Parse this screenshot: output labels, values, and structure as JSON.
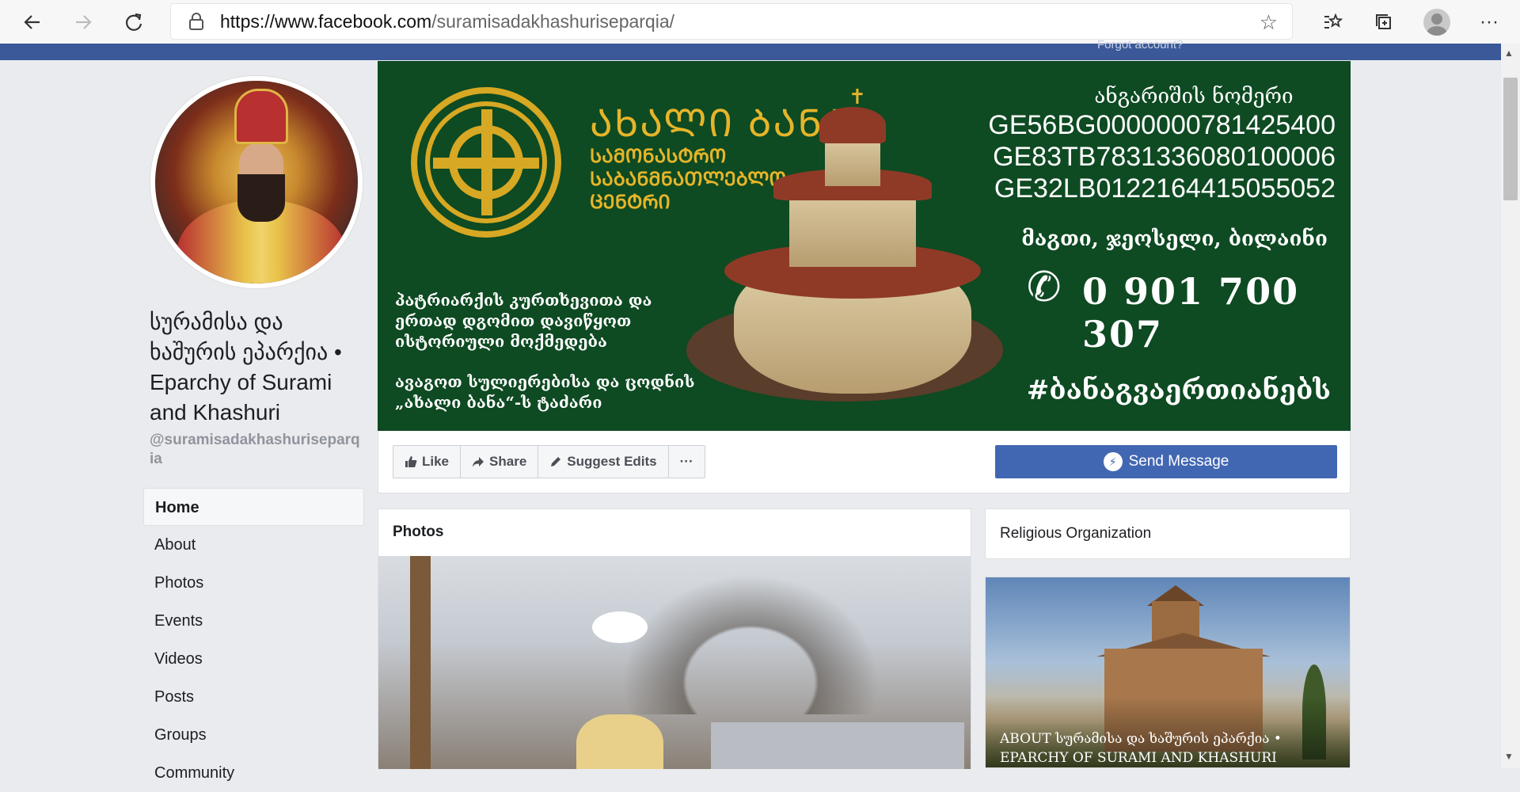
{
  "browser": {
    "url_host": "https://www.facebook.com",
    "url_path": "/suramisadakhashuriseparqia/"
  },
  "topbar": {
    "forgot_account": "Forgot account?"
  },
  "page": {
    "name": "სურამისა და ხაშურის ეპარქია • Eparchy of Surami and Khashuri",
    "handle": "@suramisadakhashuriseparqia"
  },
  "left_nav": {
    "items": [
      {
        "label": "Home",
        "active": true
      },
      {
        "label": "About"
      },
      {
        "label": "Photos"
      },
      {
        "label": "Events"
      },
      {
        "label": "Videos"
      },
      {
        "label": "Posts"
      },
      {
        "label": "Groups"
      },
      {
        "label": "Community"
      }
    ]
  },
  "cover": {
    "brand_title": "ᲐᲮᲐᲚᲘ ᲑᲐᲜᲐ",
    "brand_sub": "ᲡᲐᲛᲝᲜᲐᲡᲢᲠᲝ ᲡᲐᲑᲐᲜᲛᲜᲐᲗᲚᲔᲑᲚᲝ ᲪᲔᲜᲢᲠᲘ",
    "account_label": "ანგარიშის ნომერი",
    "accounts": [
      "GE56BG0000000781425400",
      "GE83TB7831336080100006",
      "GE32LB0122164415055052"
    ],
    "villages": "მაგთი, ჯეოსელი, ბილაინი",
    "phone": "0 901 700 307",
    "hashtag": "#ბანაგვაერთიანებს",
    "blessing_1": "პატრიარქის კურთხევითა და ერთად დგომით დავიწყოთ ისტორიული მოქმედება",
    "blessing_2": "ავაგოთ სულიერებისა და ცოდნის „ახალი ბანა“-ს ტაძარი"
  },
  "actions": {
    "like": "Like",
    "share": "Share",
    "suggest": "Suggest Edits",
    "more": "···",
    "send_message": "Send Message"
  },
  "photos": {
    "title": "Photos"
  },
  "right": {
    "category": "Religious Organization",
    "about_caption": "ABOUT სურამისა და ხაშურის ეპარქია • EPARCHY OF SURAMI AND KHASHURI"
  },
  "colors": {
    "fb_blue": "#3b5998",
    "button_blue": "#4267b2",
    "cover_green": "#0e4a22",
    "gold": "#e6b52a"
  }
}
